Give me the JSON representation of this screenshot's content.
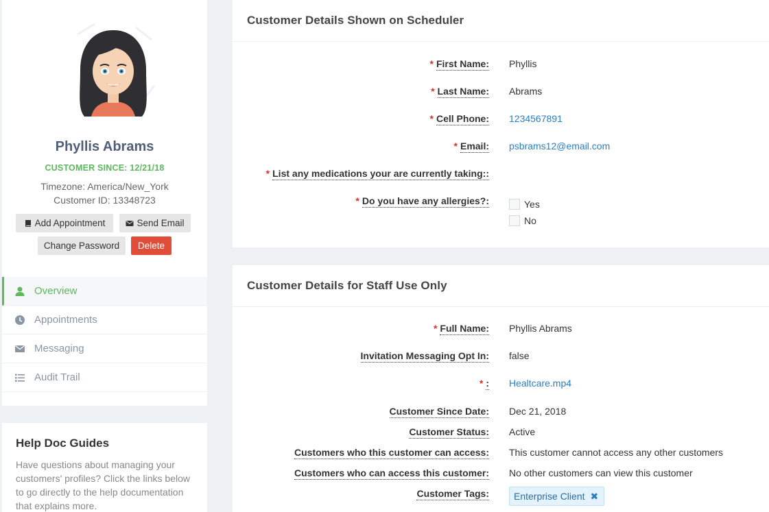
{
  "profile": {
    "name": "Phyllis Abrams",
    "since": "CUSTOMER SINCE: 12/21/18",
    "timezone": "Timezone: America/New_York",
    "customer_id": "Customer ID: 13348723"
  },
  "actions": {
    "add_appointment": "Add Appointment",
    "send_email": "Send Email",
    "change_password": "Change Password",
    "delete": "Delete"
  },
  "nav": [
    {
      "label": "Overview",
      "icon": "user-icon",
      "active": true
    },
    {
      "label": "Appointments",
      "icon": "clock-icon",
      "active": false
    },
    {
      "label": "Messaging",
      "icon": "envelope-icon",
      "active": false
    },
    {
      "label": "Audit Trail",
      "icon": "list-icon",
      "active": false
    }
  ],
  "help": {
    "title": "Help Doc Guides",
    "text": "Have questions about managing your customers' profiles? Click the links below to go directly to the help documentation that explains more."
  },
  "scheduler": {
    "title": "Customer Details Shown on Scheduler",
    "first_name_label": "First Name:",
    "first_name": "Phyllis",
    "last_name_label": "Last Name:",
    "last_name": "Abrams",
    "cell_label": "Cell Phone:",
    "cell": "1234567891",
    "email_label": "Email:",
    "email": "psbrams12@email.com",
    "medications_label": "List any medications your are currently taking::",
    "allergies_label": "Do you have any allergies?:",
    "allergy_yes": "Yes",
    "allergy_no": "No"
  },
  "staff": {
    "title": "Customer Details for Staff Use Only",
    "full_name_label": "Full Name:",
    "full_name": "Phyllis Abrams",
    "invite_label": "Invitation Messaging Opt In:",
    "invite": "false",
    "file_label": ":",
    "file": "Healtcare.mp4",
    "since_label": "Customer Since Date:",
    "since": "Dec 21, 2018",
    "status_label": "Customer Status:",
    "status": "Active",
    "can_access_label": "Customers who this customer can access:",
    "can_access": "This customer cannot access any other customers",
    "accessed_by_label": "Customers who can access this customer:",
    "accessed_by": "No other customers can view this customer",
    "tags_label": "Customer Tags:",
    "tag": "Enterprise Client",
    "tag_remove": "✖"
  },
  "required_mark": "*",
  "colors": {
    "accent": "#5cb85c",
    "link": "#2a7fc0",
    "danger": "#e04e3a"
  }
}
